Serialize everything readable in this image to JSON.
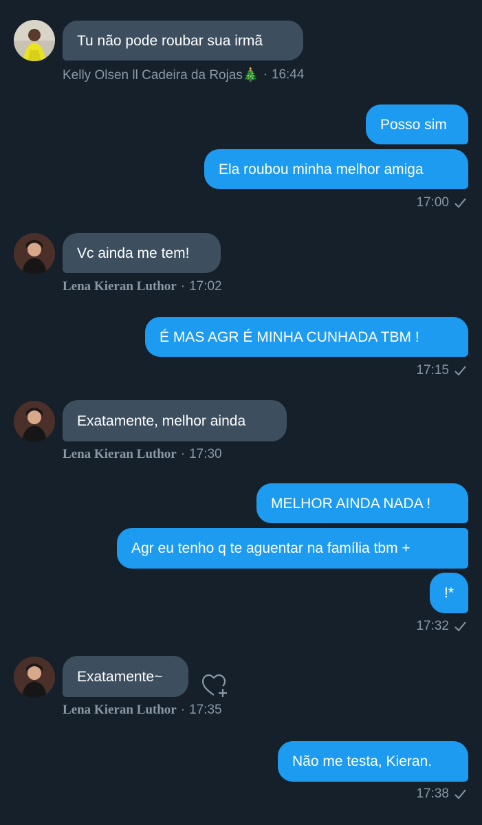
{
  "messages": [
    {
      "dir": "in",
      "text": "Tu não pode roubar sua irmã",
      "sender": "Kelly Olsen ll Cadeira da Rojas🎄",
      "time": "16:44"
    },
    {
      "dir": "out",
      "text": "Posso sim"
    },
    {
      "dir": "out",
      "text": "Ela roubou minha melhor amiga",
      "time": "17:00"
    },
    {
      "dir": "in",
      "text": "Vc ainda me tem!",
      "sender": "Lena Kieran Luthor",
      "time": "17:02"
    },
    {
      "dir": "out",
      "text": "É MAS AGR É MINHA CUNHADA TBM !",
      "time": "17:15"
    },
    {
      "dir": "in",
      "text": "Exatamente, melhor ainda",
      "sender": "Lena Kieran Luthor",
      "time": "17:30"
    },
    {
      "dir": "out",
      "text": "MELHOR AINDA NADA !"
    },
    {
      "dir": "out",
      "text": "Agr eu tenho q te aguentar na família tbm +"
    },
    {
      "dir": "out",
      "text": "!*",
      "time": "17:32"
    },
    {
      "dir": "in",
      "text": "Exatamente~",
      "sender": "Lena Kieran Luthor",
      "time": "17:35"
    },
    {
      "dir": "out",
      "text": "Não me testa, Kieran.",
      "time": "17:38"
    }
  ],
  "separator": "·",
  "icons": {
    "read": "checkmark-icon",
    "react": "heart-plus-icon"
  },
  "colors": {
    "background": "#15202b",
    "incoming": "#3d4f5f",
    "outgoing": "#1d9bf0",
    "meta": "#8b98a5"
  }
}
